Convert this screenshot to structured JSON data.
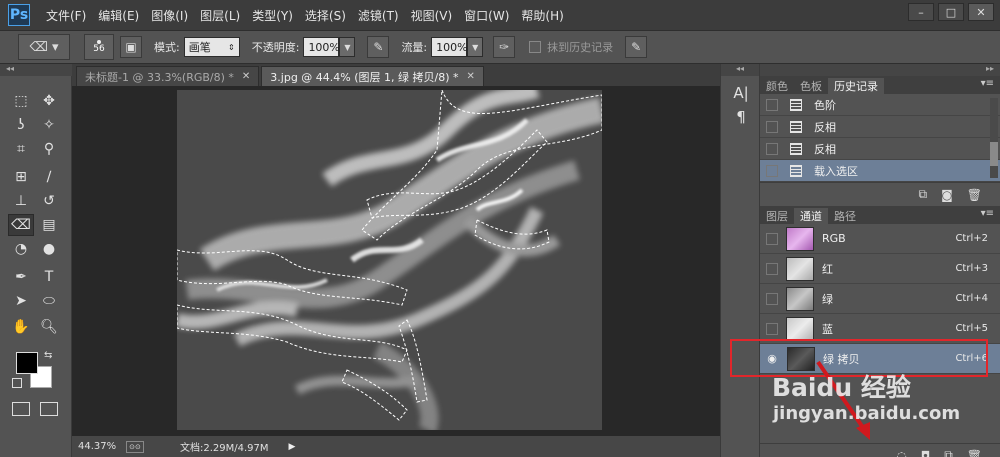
{
  "app": {
    "logo": "Ps",
    "menu": [
      "文件(F)",
      "编辑(E)",
      "图像(I)",
      "图层(L)",
      "类型(Y)",
      "选择(S)",
      "滤镜(T)",
      "视图(V)",
      "窗口(W)",
      "帮助(H)"
    ],
    "window_controls": [
      "–",
      "□",
      "✕"
    ]
  },
  "options": {
    "brush_size": "56",
    "mode_label": "模式:",
    "mode_value": "画笔",
    "opacity_label": "不透明度:",
    "opacity_value": "100%",
    "flow_label": "流量:",
    "flow_value": "100%",
    "erase_history_label": "抹到历史记录"
  },
  "documents": {
    "tabs": [
      {
        "label": "未标题-1 @ 33.3%(RGB/8) *",
        "close": "✕"
      },
      {
        "label": "3.jpg @ 44.4% (图层 1, 绿 拷贝/8) *",
        "close": "✕"
      }
    ],
    "zoom": "44.37%",
    "doc_info": "文档:2.29M/4.97M"
  },
  "side_tools": {
    "character": "A|",
    "paragraph": "¶"
  },
  "history_panel": {
    "tabs": [
      "颜色",
      "色板",
      "历史记录"
    ],
    "items": [
      "色阶",
      "反相",
      "反相",
      "载入选区"
    ]
  },
  "channels_panel": {
    "tabs": [
      "图层",
      "通道",
      "路径"
    ],
    "channels": [
      {
        "name": "RGB",
        "shortcut": "Ctrl+2"
      },
      {
        "name": "红",
        "shortcut": "Ctrl+3"
      },
      {
        "name": "绿",
        "shortcut": "Ctrl+4"
      },
      {
        "name": "蓝",
        "shortcut": "Ctrl+5"
      },
      {
        "name": "绿 拷贝",
        "shortcut": "Ctrl+6"
      }
    ]
  },
  "watermark": {
    "brand": "Baidu 经验",
    "url": "jingyan.baidu.com"
  },
  "colors": {
    "accent_selection": "#6d7f97",
    "highlight_red": "#e2262b",
    "ps_blue": "#4aa0e8"
  }
}
